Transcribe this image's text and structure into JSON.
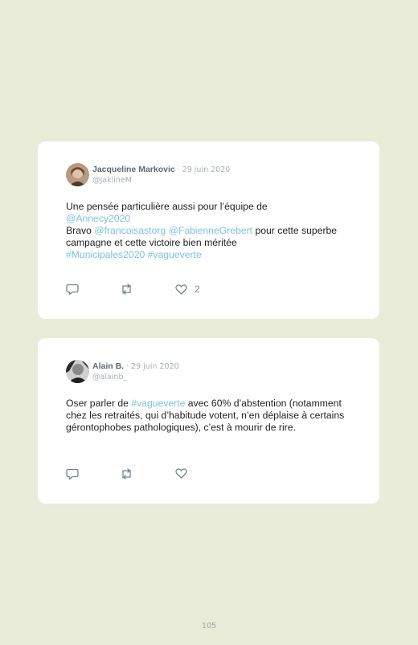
{
  "tweets": [
    {
      "author": "Jacqueline Markovic",
      "date": "· 29 juin 2020",
      "handle": "@JaklineM",
      "text_parts": [
        {
          "text": "Une pensée particulière aussi pour l’équipe de",
          "link": false
        },
        {
          "text": "@Annecy2020",
          "link": true
        },
        {
          "text": "Bravo",
          "link": false
        },
        {
          "text": "@francoisastorg",
          "link": true
        },
        {
          "text": "@FabienneGrebert",
          "link": true
        },
        {
          "text": "pour cette superbe campagne et cette victoire bien méritée",
          "link": false
        },
        {
          "text": "#Municipales2020",
          "link": true
        },
        {
          "text": "#vagueverte",
          "link": true
        }
      ],
      "likes": "2",
      "avatar_icon": "avatar-photo-woman"
    },
    {
      "author": "Alain B.",
      "date": "· 29 juin 2020",
      "handle": "@alainb_",
      "text_parts": [
        {
          "text": "Oser parler de",
          "link": false
        },
        {
          "text": "#vagueverte",
          "link": true
        },
        {
          "text": "avec 60% d’abstention (notamment chez les retraités, qui d’habitude votent, n’en déplaise à certains gérontophobes pathologiques), c’est à mourir de rire.",
          "link": false
        }
      ],
      "likes": "",
      "avatar_icon": "avatar-photo-man"
    }
  ],
  "icons": {
    "reply": "comment-icon",
    "retweet": "retweet-icon",
    "like": "heart-icon"
  },
  "colors": {
    "background": "#e8ecd8",
    "card": "#ffffff",
    "link": "#7cc1e3",
    "icon": "#6f8490"
  },
  "page_number": "105"
}
